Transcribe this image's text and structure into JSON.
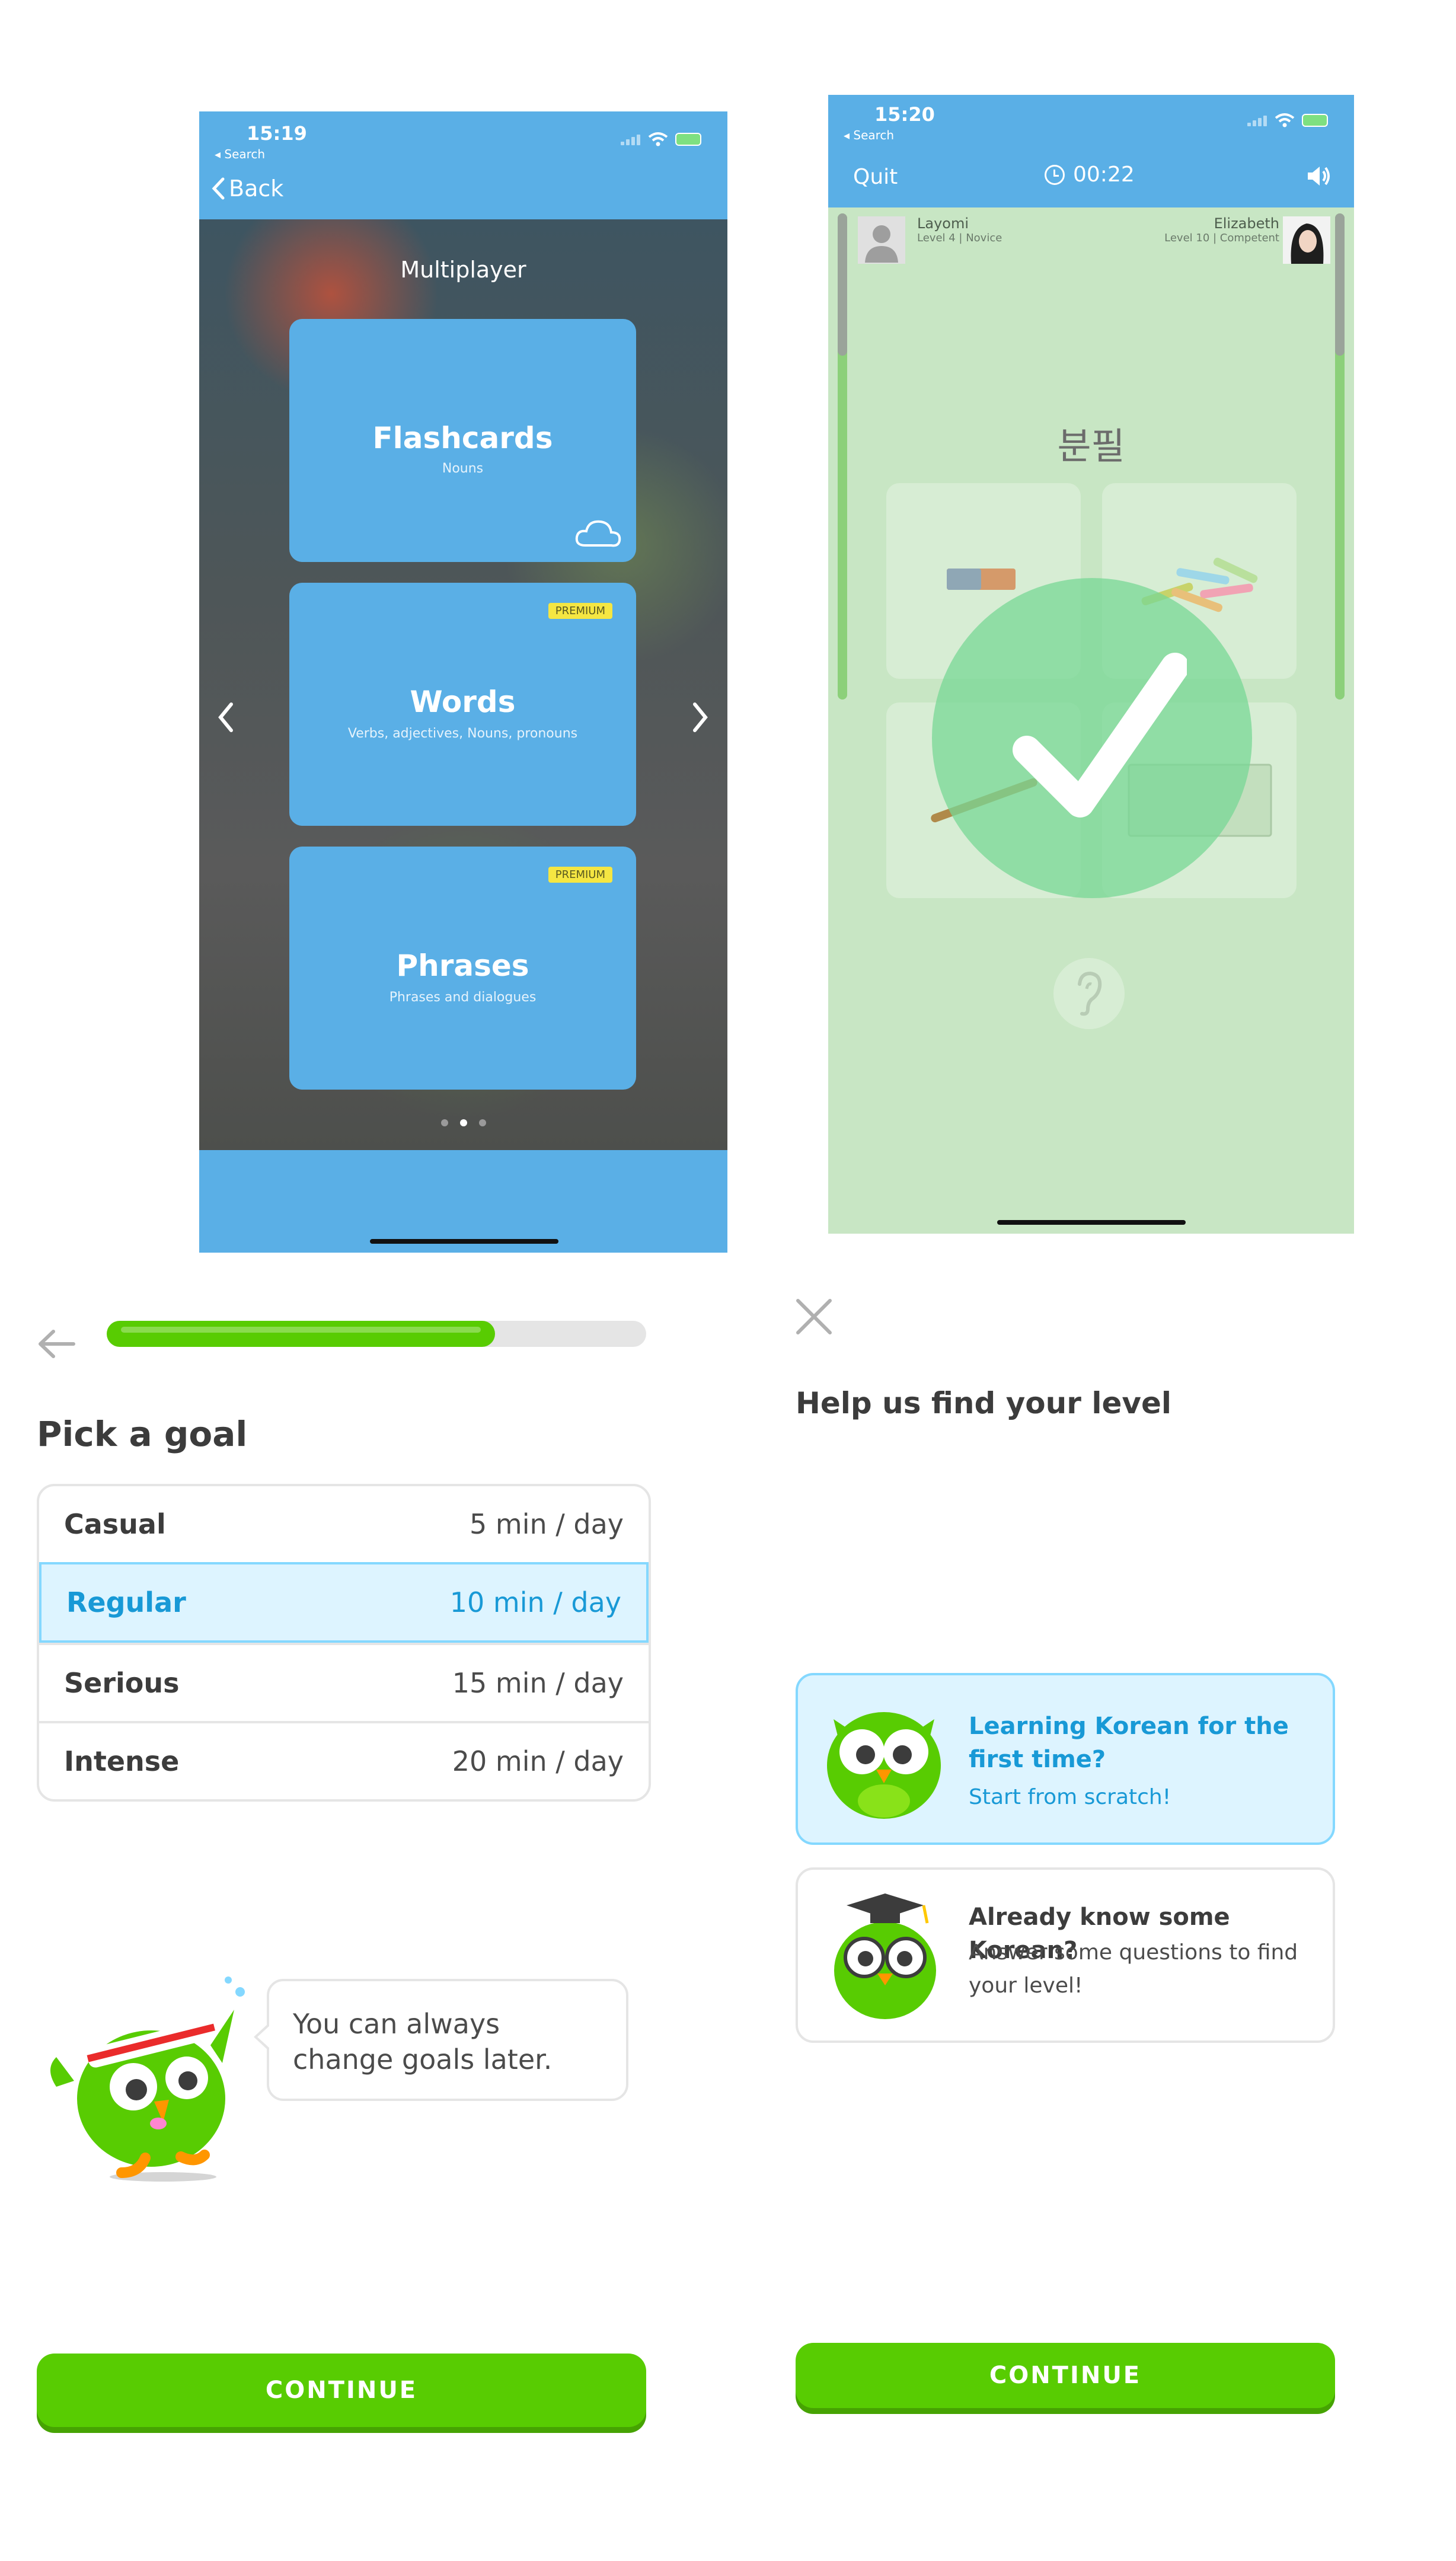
{
  "phone1": {
    "status_time": "15:19",
    "status_back": "◂ Search",
    "nav_back": "Back",
    "title": "Multiplayer",
    "cards": [
      {
        "title": "Flashcards",
        "subtitle": "Nouns",
        "badge": ""
      },
      {
        "title": "Words",
        "subtitle": "Verbs, adjectives, Nouns, pronouns",
        "badge": "PREMIUM"
      },
      {
        "title": "Phrases",
        "subtitle": "Phrases and dialogues",
        "badge": "PREMIUM"
      }
    ],
    "colors": {
      "bar": "#5aafe6",
      "card": "#5aafe6",
      "badge": "#f5e642"
    }
  },
  "phone2": {
    "status_time": "15:20",
    "status_back": "◂ Search",
    "quit_label": "Quit",
    "timer": "00:22",
    "player_left": {
      "name": "Layomi",
      "level": "Level 4 | Novice"
    },
    "player_right": {
      "name": "Elizabeth",
      "level": "Level 10 | Competent"
    },
    "word": "분필",
    "colors": {
      "bg": "#c8e6c4",
      "check": "#78d796"
    }
  },
  "goal": {
    "progress": 0.72,
    "heading": "Pick a goal",
    "options": [
      {
        "name": "Casual",
        "time": "5 min / day"
      },
      {
        "name": "Regular",
        "time": "10 min / day"
      },
      {
        "name": "Serious",
        "time": "15 min / day"
      },
      {
        "name": "Intense",
        "time": "20 min / day"
      }
    ],
    "selected_index": 1,
    "bubble": "You can always change goals later.",
    "continue": "CONTINUE"
  },
  "level": {
    "heading": "Help us find your level",
    "options": [
      {
        "title": "Learning Korean for the first time?",
        "subtitle": "Start from scratch!"
      },
      {
        "title": "Already know some Korean?",
        "subtitle": "Answer some questions to find your level!"
      }
    ],
    "continue": "CONTINUE",
    "colors": {
      "green": "#58cc02",
      "blue": "#1899d6",
      "blue_bg": "#ddf4ff"
    }
  }
}
